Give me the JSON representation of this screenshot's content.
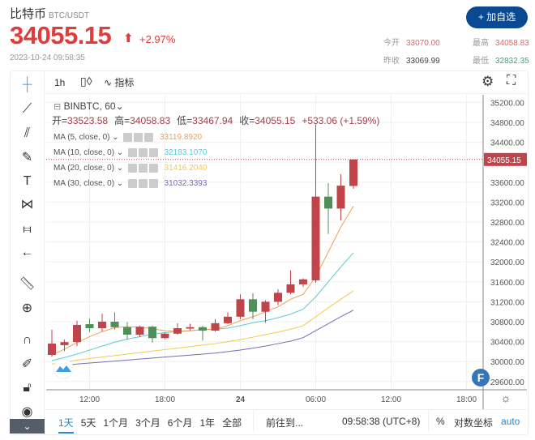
{
  "header": {
    "name": "比特币",
    "pair": "BTC/USDT",
    "price": "34055.15",
    "arrow": "⬆",
    "change": "+2.97%",
    "datetime": "2023-10-24 09:58:35",
    "add_button": "+ 加自选",
    "stats": {
      "open_label": "今开",
      "open": "33070.00",
      "high_label": "最高",
      "high": "34058.83",
      "prev_label": "昨收",
      "prev": "33069.99",
      "low_label": "最低",
      "low": "32832.35"
    }
  },
  "toolbar": {
    "interval": "1h",
    "indicators": "指标"
  },
  "legend": {
    "symbol": "BINBTC, 60",
    "ohlc": [
      [
        "开=",
        "33523.58"
      ],
      [
        "高=",
        "34058.83"
      ],
      [
        "低=",
        "33467.94"
      ],
      [
        "收=",
        "34055.15"
      ]
    ],
    "change": "+533.06 (+1.59%)",
    "mas": [
      {
        "label": "MA (5, close, 0)",
        "value": "33119.8920",
        "color": "#f0a050"
      },
      {
        "label": "MA (10, close, 0)",
        "value": "32183.1070",
        "color": "#5cc8d8"
      },
      {
        "label": "MA (20, close, 0)",
        "value": "31416.2040",
        "color": "#f2c94c"
      },
      {
        "label": "MA (30, close, 0)",
        "value": "31032.3393",
        "color": "#7b6bb0"
      }
    ]
  },
  "bottom": {
    "ranges": [
      "1天",
      "5天",
      "1个月",
      "3个月",
      "6个月",
      "1年",
      "全部"
    ],
    "goto": "前往到...",
    "clock": "09:58:38 (UTC+8)",
    "percent": "%",
    "log": "对数坐标",
    "auto": "auto"
  },
  "chart_data": {
    "type": "candlestick",
    "up_color": "#c0444a",
    "down_color": "#4e8f5a",
    "ylim": [
      29600,
      35200
    ],
    "yticks": [
      "35200.00",
      "34800.00",
      "34400.00",
      "33600.00",
      "33200.00",
      "32800.00",
      "32400.00",
      "32000.00",
      "31600.00",
      "31200.00",
      "30800.00",
      "30400.00",
      "30000.00",
      "29600.00"
    ],
    "last_price_label": "34055.15",
    "xticks": [
      {
        "label": "12:00",
        "hour": 3
      },
      {
        "label": "18:00",
        "hour": 9
      },
      {
        "label": "24",
        "hour": 15
      },
      {
        "label": "06:00",
        "hour": 21
      },
      {
        "label": "12:00",
        "hour": 27
      },
      {
        "label": "18:00",
        "hour": 33
      }
    ],
    "candles": [
      [
        30133,
        30637,
        30100,
        30361
      ],
      [
        30330,
        30440,
        30210,
        30390
      ],
      [
        30390,
        30820,
        30310,
        30735
      ],
      [
        30750,
        30860,
        30590,
        30670
      ],
      [
        30670,
        30960,
        30600,
        30800
      ],
      [
        30800,
        30990,
        30640,
        30690
      ],
      [
        30690,
        30790,
        30440,
        30540
      ],
      [
        30540,
        30720,
        30490,
        30700
      ],
      [
        30700,
        30720,
        30380,
        30470
      ],
      [
        30470,
        30580,
        30450,
        30560
      ],
      [
        30560,
        30770,
        30540,
        30670
      ],
      [
        30660,
        30760,
        30620,
        30690
      ],
      [
        30690,
        30720,
        30420,
        30620
      ],
      [
        30620,
        30850,
        30600,
        30770
      ],
      [
        30770,
        30990,
        30750,
        30900
      ],
      [
        30900,
        31350,
        30850,
        31250
      ],
      [
        31250,
        31370,
        30850,
        31000
      ],
      [
        31000,
        31230,
        30780,
        31200
      ],
      [
        31200,
        31450,
        31130,
        31380
      ],
      [
        31380,
        31830,
        31350,
        31550
      ],
      [
        31550,
        31670,
        31500,
        31650
      ],
      [
        31630,
        34760,
        31580,
        33310
      ],
      [
        33310,
        33580,
        32560,
        33070
      ],
      [
        33070,
        33760,
        32830,
        33530
      ],
      [
        33523.58,
        34058.83,
        33467.94,
        34055.15
      ]
    ],
    "ma5": [
      30130,
      30250,
      30380,
      30500,
      30600,
      30680,
      30700,
      30690,
      30660,
      30620,
      30610,
      30620,
      30640,
      30650,
      30720,
      30820,
      30900,
      31000,
      31100,
      31250,
      31350,
      31700,
      32200,
      32700,
      33119.89
    ],
    "ma10": [
      30020,
      30080,
      30150,
      30230,
      30310,
      30390,
      30450,
      30500,
      30550,
      30580,
      30600,
      30620,
      30640,
      30650,
      30670,
      30720,
      30780,
      30820,
      30880,
      30950,
      31050,
      31300,
      31600,
      31900,
      32183.11
    ],
    "ma20": [
      29950,
      29990,
      30030,
      30060,
      30090,
      30120,
      30150,
      30180,
      30210,
      30240,
      30270,
      30300,
      30330,
      30360,
      30400,
      30440,
      30490,
      30540,
      30590,
      30650,
      30720,
      30900,
      31080,
      31250,
      31416.2
    ],
    "ma30": [
      null,
      29920,
      29950,
      29970,
      29990,
      30010,
      30030,
      30050,
      30070,
      30090,
      30110,
      30130,
      30150,
      30170,
      30200,
      30230,
      30270,
      30310,
      30360,
      30410,
      30480,
      30620,
      30760,
      30900,
      31032.34
    ]
  }
}
